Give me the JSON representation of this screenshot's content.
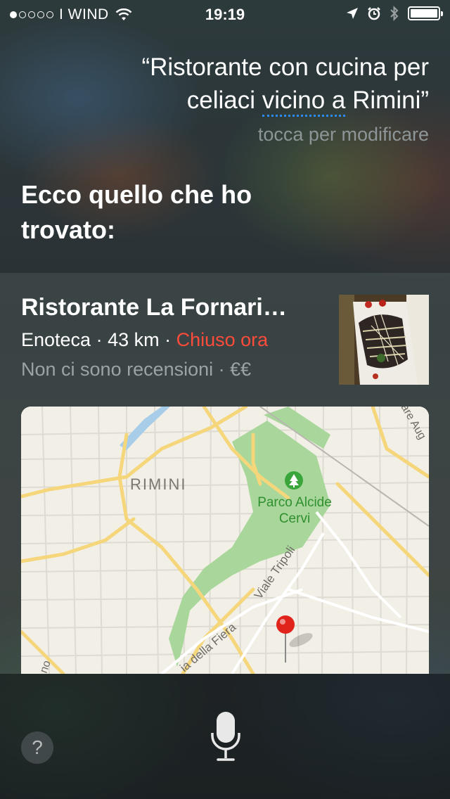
{
  "status_bar": {
    "carrier": "I WIND",
    "time": "19:19"
  },
  "query": {
    "line1": "“Ristorante con cucina per",
    "line2_pre": "celiaci ",
    "line2_underlined": "vicino a",
    "line2_post": " Rimini”",
    "edit_hint": "tocca per modificare"
  },
  "answer_heading": "Ecco quello che ho trovato:",
  "result": {
    "title": "Ristorante La Fornari…",
    "category": "Enoteca",
    "distance": "43 km",
    "status": "Chiuso ora",
    "separator": " · ",
    "reviews": "Non ci sono recensioni",
    "price": "€€"
  },
  "map": {
    "city_label": "RIMINI",
    "park_label_1": "Parco Alcide",
    "park_label_2": "Cervi",
    "street_1": "Viale Tripoli",
    "street_2": "ia della Fiera",
    "edge_label_right": "are Aug",
    "edge_label_left": "no"
  },
  "bottom": {
    "help_label": "?"
  },
  "colors": {
    "accent_blue": "#2a8cff",
    "closed_red": "#ff4b3a",
    "park_green": "#3aa53a"
  }
}
